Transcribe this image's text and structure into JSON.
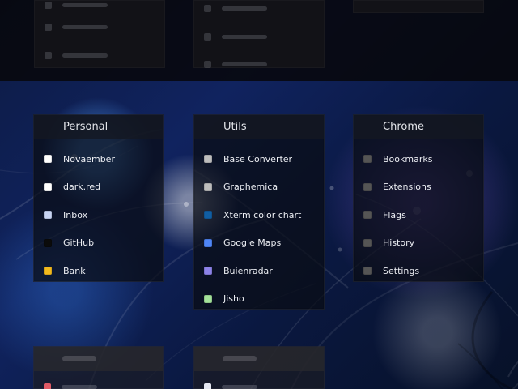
{
  "columns": [
    {
      "title": "Personal",
      "items": [
        {
          "label": "Novaember",
          "color": "#ffffff"
        },
        {
          "label": "dark.red",
          "color": "#ffffff"
        },
        {
          "label": "Inbox",
          "color": "#c7d3f3"
        },
        {
          "label": "GitHub",
          "color": "#0b0b0b"
        },
        {
          "label": "Bank",
          "color": "#f2b91d"
        }
      ]
    },
    {
      "title": "Utils",
      "items": [
        {
          "label": "Base Converter",
          "color": "#bdbdbd"
        },
        {
          "label": "Graphemica",
          "color": "#bdbdbd"
        },
        {
          "label": "Xterm color chart",
          "color": "#115ea3"
        },
        {
          "label": "Google Maps",
          "color": "#4f86f7"
        },
        {
          "label": "Buienradar",
          "color": "#8c82e8"
        },
        {
          "label": "Jisho",
          "color": "#a4e29a"
        }
      ]
    },
    {
      "title": "Chrome",
      "items": [
        {
          "label": "Bookmarks",
          "color": "#555555"
        },
        {
          "label": "Extensions",
          "color": "#555555"
        },
        {
          "label": "Flags",
          "color": "#555555"
        },
        {
          "label": "History",
          "color": "#555555"
        },
        {
          "label": "Settings",
          "color": "#555555"
        }
      ]
    }
  ],
  "bottom_colors": [
    "#e05b66",
    "#e5e7f2"
  ]
}
